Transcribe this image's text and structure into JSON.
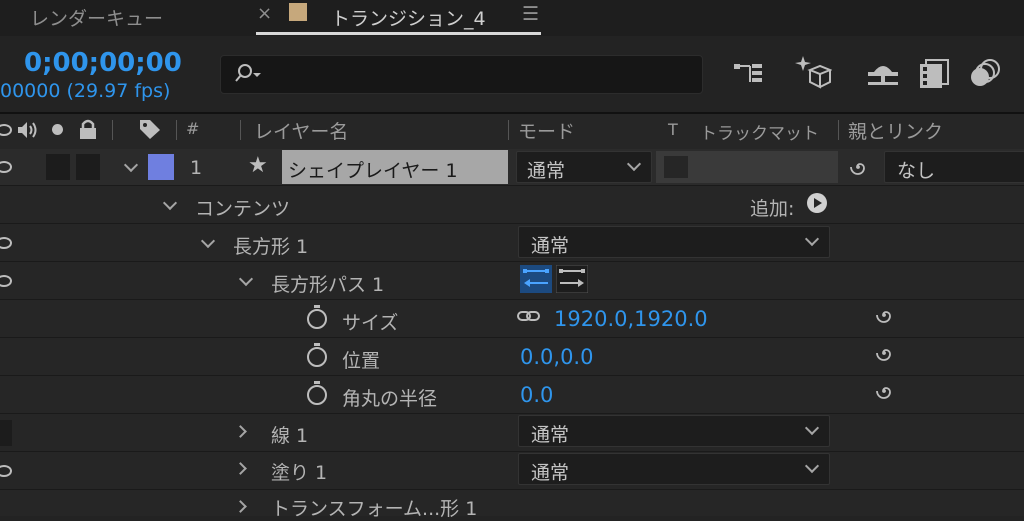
{
  "tabs": [
    {
      "label": "レンダーキュー"
    },
    {
      "label": "トランジション_4",
      "close": "×",
      "menu": "☰"
    }
  ],
  "header": {
    "timecode": "0;00;00;00",
    "fps": "00000 (29.97 fps)",
    "search_icon": "magnifier-icon",
    "icons": [
      "composition-flowchart-icon",
      "draft-3d-icon",
      "shy-layers-icon",
      "frame-blending-icon",
      "motion-blur-icon"
    ]
  },
  "columns": {
    "hash": "#",
    "layer_name": "レイヤー名",
    "mode": "モード",
    "t": "T",
    "trackmatte": "トラックマット",
    "parent": "親とリンク"
  },
  "layer": {
    "number": "1",
    "name": "シェイプレイヤー 1",
    "mode": "通常",
    "parent": "なし",
    "label_color": "#6f7fe0"
  },
  "tree": {
    "contents": "コンテンツ",
    "add_label": "追加:",
    "rect_group": "長方形 1",
    "rect_group_mode": "通常",
    "rect_path": "長方形パス 1",
    "size_label": "サイズ",
    "size_value": "1920.0,1920.0",
    "position_label": "位置",
    "position_value": "0.0,0.0",
    "roundness_label": "角丸の半径",
    "roundness_value": "0.0",
    "stroke": "線 1",
    "stroke_mode": "通常",
    "fill": "塗り 1",
    "fill_mode": "通常",
    "transform": "トランスフォーム...形 1"
  }
}
